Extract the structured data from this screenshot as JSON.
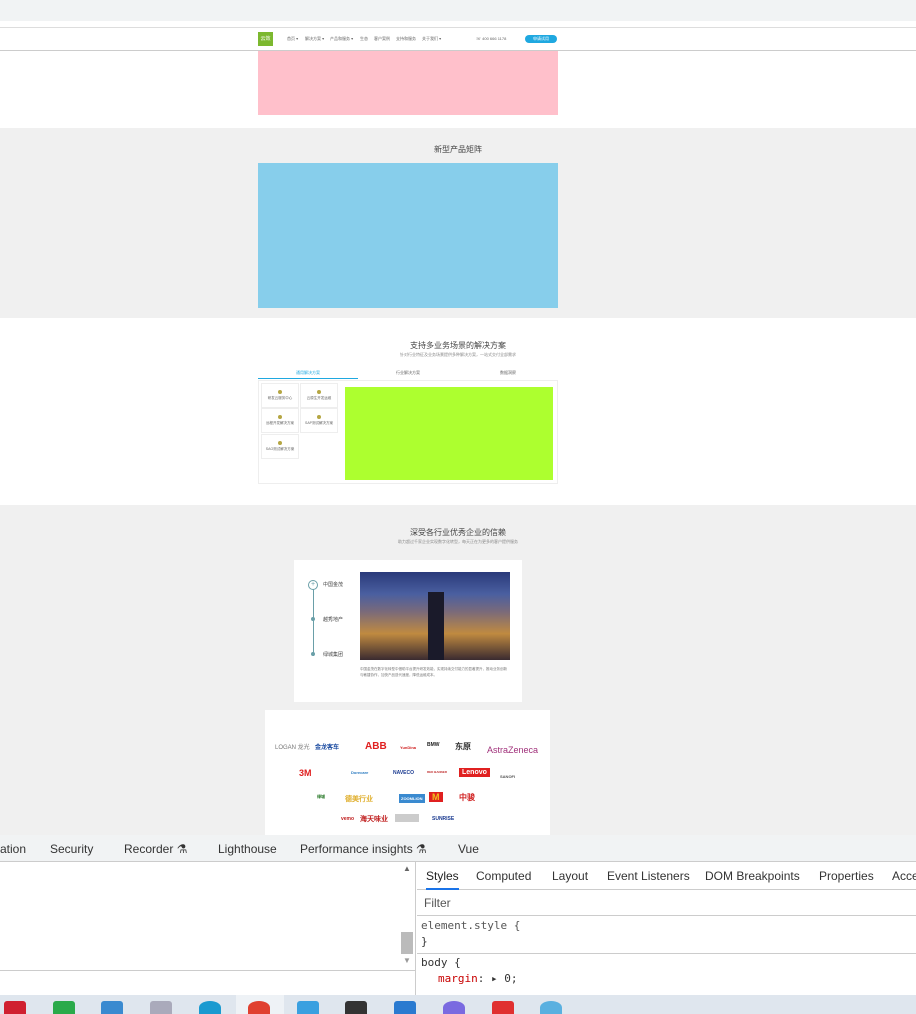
{
  "nav": {
    "logo": "云效",
    "items": [
      "首页 ▾",
      "解决方案 ▾",
      "产品和服务 ▾",
      "生态",
      "客户案例",
      "支持和服务",
      "关于我们 ▾"
    ],
    "phone": "400 666 1178",
    "cta": "申请试用"
  },
  "products": {
    "title": "新型产品矩阵"
  },
  "solutions": {
    "title": "支持多业务场景的解决方案",
    "subtitle": "针对行业特征及业务场景提供多种解决方案，一站式交付全部需求",
    "tabs": [
      "通用解决方案",
      "行业解决方案",
      "数据洞察"
    ],
    "cards": [
      "研发云服务中心",
      "云原生开发运维",
      "远程开发解决方案",
      "SAP测试解决方案",
      "SAO测试解决方案"
    ]
  },
  "customers": {
    "title": "深受各行业优秀企业的信赖",
    "subtitle": "助力超过千家企业实现数字化转型，每天正在为更多的客户提供服务",
    "timeline": [
      "中国金茂",
      "越秀地产",
      "绿城集团"
    ],
    "case_text": "中国金茂在数字化转型中借助平台提升研发效能，实现持续交付能力的显著提升，推动业务创新与敏捷协作，加快产品迭代速度，降低运维成本。",
    "logos": [
      "LOGAN 龙光",
      "金龙客车",
      "ABB",
      "YunDina",
      "BMW",
      "东原",
      "AstraZeneca",
      "3M",
      "Dorecare",
      "NAVECO",
      "RED BANNER",
      "Lenovo",
      "SANOFI",
      "绿城",
      "德美行业",
      "ZOOMLION",
      "M",
      "中骏",
      "vemo",
      "海天味业",
      "",
      "SUNRISE"
    ]
  },
  "devtools": {
    "tabs": [
      "ation",
      "Security",
      "Recorder ⚗",
      "Lighthouse",
      "Performance insights ⚗",
      "Vue"
    ],
    "style_tabs": [
      "Styles",
      "Computed",
      "Layout",
      "Event Listeners",
      "DOM Breakpoints",
      "Properties",
      "Acce"
    ],
    "filter_placeholder": "Filter",
    "rule1": "element.style {",
    "rule1_close": "}",
    "rule2": "body {",
    "prop": "margin",
    "value": "0;"
  },
  "taskbar": {
    "apps": [
      "netease-music",
      "app-green",
      "app-blue",
      "notepad",
      "edge",
      "chrome",
      "explorer",
      "terminal",
      "vscode",
      "app-purple",
      "wps",
      "search"
    ]
  }
}
